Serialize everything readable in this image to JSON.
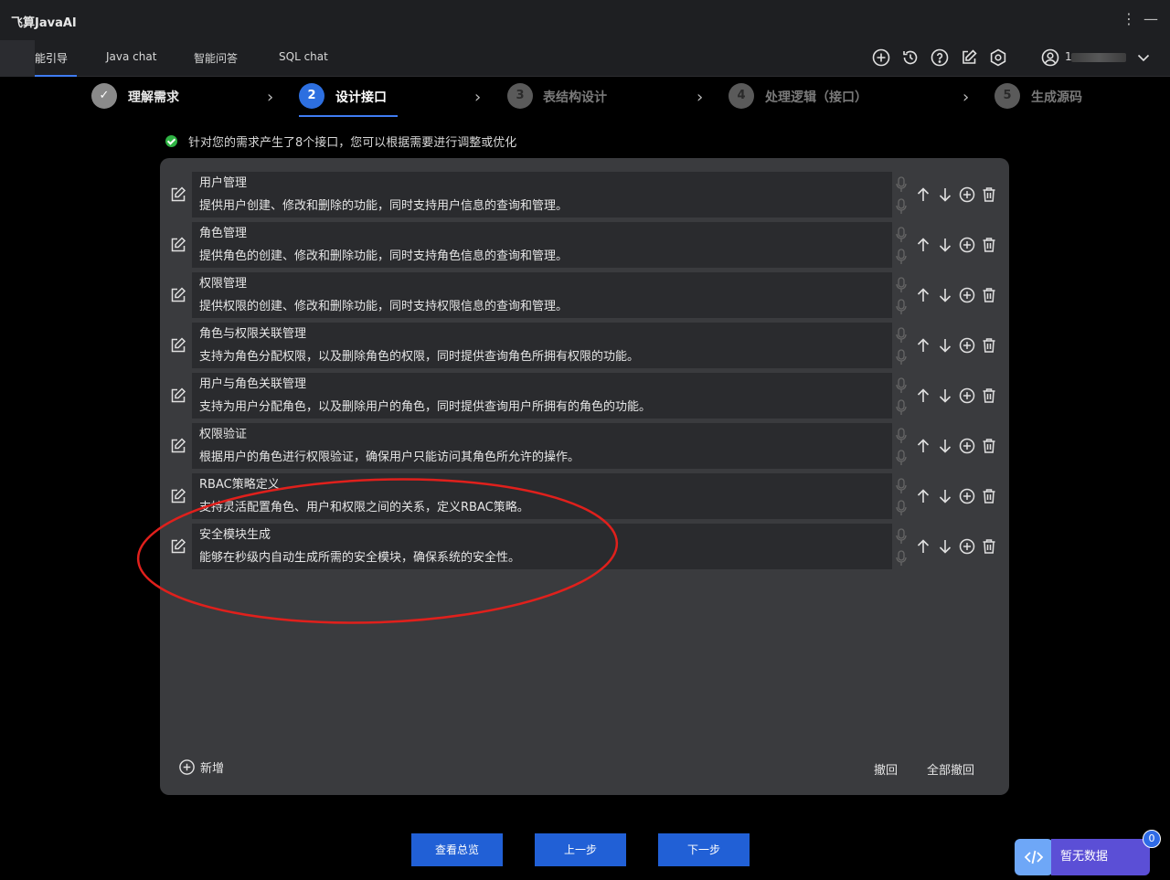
{
  "app": {
    "title": "飞算JavaAI"
  },
  "tabs": [
    {
      "label": "能引导",
      "active": true
    },
    {
      "label": "Java chat"
    },
    {
      "label": "智能问答"
    },
    {
      "label": "SQL chat"
    }
  ],
  "toolbar": {
    "icons": [
      "add-circle-icon",
      "history-icon",
      "help-icon",
      "edit-icon",
      "settings-icon",
      "user-icon",
      "chevron-down-icon"
    ],
    "user_name": "1"
  },
  "steps": [
    {
      "number": "✓",
      "label": "理解需求",
      "state": "done"
    },
    {
      "number": "2",
      "label": "设计接口",
      "state": "active"
    },
    {
      "number": "3",
      "label": "表结构设计",
      "state": "todo"
    },
    {
      "number": "4",
      "label": "处理逻辑（接口）",
      "state": "todo"
    },
    {
      "number": "5",
      "label": "生成源码",
      "state": "todo"
    }
  ],
  "notice": "针对您的需求产生了8个接口，您可以根据需要进行调整或优化",
  "interfaces": [
    {
      "title": "用户管理",
      "desc": "提供用户创建、修改和删除的功能，同时支持用户信息的查询和管理。"
    },
    {
      "title": "角色管理",
      "desc": "提供角色的创建、修改和删除功能，同时支持角色信息的查询和管理。"
    },
    {
      "title": "权限管理",
      "desc": "提供权限的创建、修改和删除功能，同时支持权限信息的查询和管理。"
    },
    {
      "title": "角色与权限关联管理",
      "desc": "支持为角色分配权限，以及删除角色的权限，同时提供查询角色所拥有权限的功能。"
    },
    {
      "title": "用户与角色关联管理",
      "desc": "支持为用户分配角色，以及删除用户的角色，同时提供查询用户所拥有的角色的功能。"
    },
    {
      "title": "权限验证",
      "desc": "根据用户的角色进行权限验证，确保用户只能访问其角色所允许的操作。"
    },
    {
      "title": "RBAC策略定义",
      "desc": "支持灵活配置角色、用户和权限之间的关系，定义RBAC策略。"
    },
    {
      "title": "安全模块生成",
      "desc": "能够在秒级内自动生成所需的安全模块，确保系统的安全性。"
    }
  ],
  "panel": {
    "add_label": "新增",
    "undo_label": "撤回",
    "undo_all_label": "全部撤回"
  },
  "footer": {
    "overview_label": "查看总览",
    "prev_label": "上一步",
    "next_label": "下一步"
  },
  "widget": {
    "nodata_label": "暂无数据",
    "badge_count": "0"
  },
  "colors": {
    "accent": "#2160d6",
    "panel_bg": "#3a3b3e",
    "row_bg": "#2a2b2e",
    "annotation": "#e0201c",
    "success": "#2fb344"
  }
}
